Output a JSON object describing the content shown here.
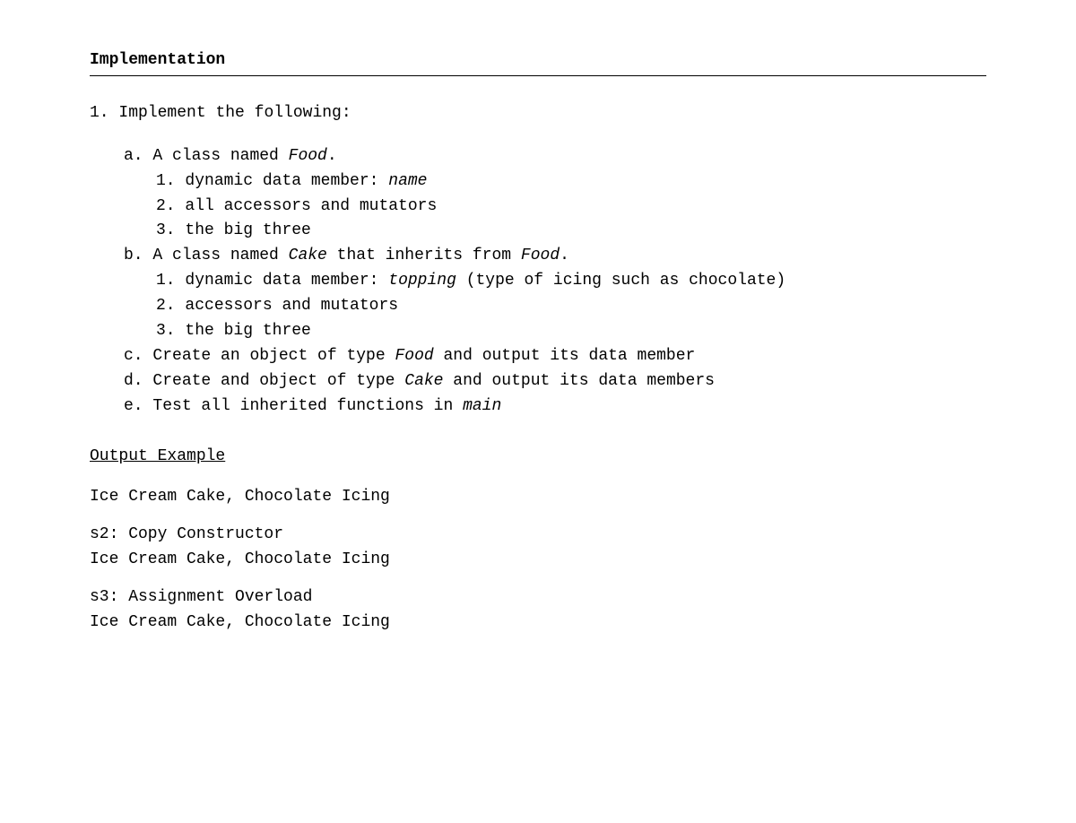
{
  "title": "Implementation",
  "q1": {
    "num": "1.",
    "text": "Implement the following:"
  },
  "a": {
    "label": "a.",
    "pre": "A class named ",
    "class": "Food",
    "post": ".",
    "i1": {
      "n": "1.",
      "pre": "dynamic data member: ",
      "ital": "name"
    },
    "i2": {
      "n": "2.",
      "text": "all accessors and mutators"
    },
    "i3": {
      "n": "3.",
      "text": "the big three"
    }
  },
  "b": {
    "label": "b.",
    "pre": "A class named ",
    "class": "Cake",
    "mid": " that inherits from ",
    "class2": "Food",
    "post": ".",
    "i1": {
      "n": "1.",
      "pre": "dynamic data member: ",
      "ital": "topping",
      "post": " (type of icing such as chocolate)"
    },
    "i2": {
      "n": "2.",
      "text": "accessors and mutators"
    },
    "i3": {
      "n": "3.",
      "text": "the big three"
    }
  },
  "c": {
    "label": "c.",
    "pre": "Create an object of type ",
    "ital": "Food",
    "post": " and output its data member"
  },
  "d": {
    "label": "d.",
    "pre": "Create and object of type ",
    "ital": "Cake",
    "post": " and output its data members"
  },
  "e": {
    "label": "e.",
    "pre": "Test all inherited functions in ",
    "ital": "main"
  },
  "output": {
    "heading": "Output Example",
    "g1": {
      "l1": "Ice Cream Cake, Chocolate Icing"
    },
    "g2": {
      "l1": "s2: Copy Constructor",
      "l2": "Ice Cream Cake, Chocolate Icing"
    },
    "g3": {
      "l1": "s3: Assignment Overload",
      "l2": "Ice Cream Cake, Chocolate Icing"
    }
  }
}
